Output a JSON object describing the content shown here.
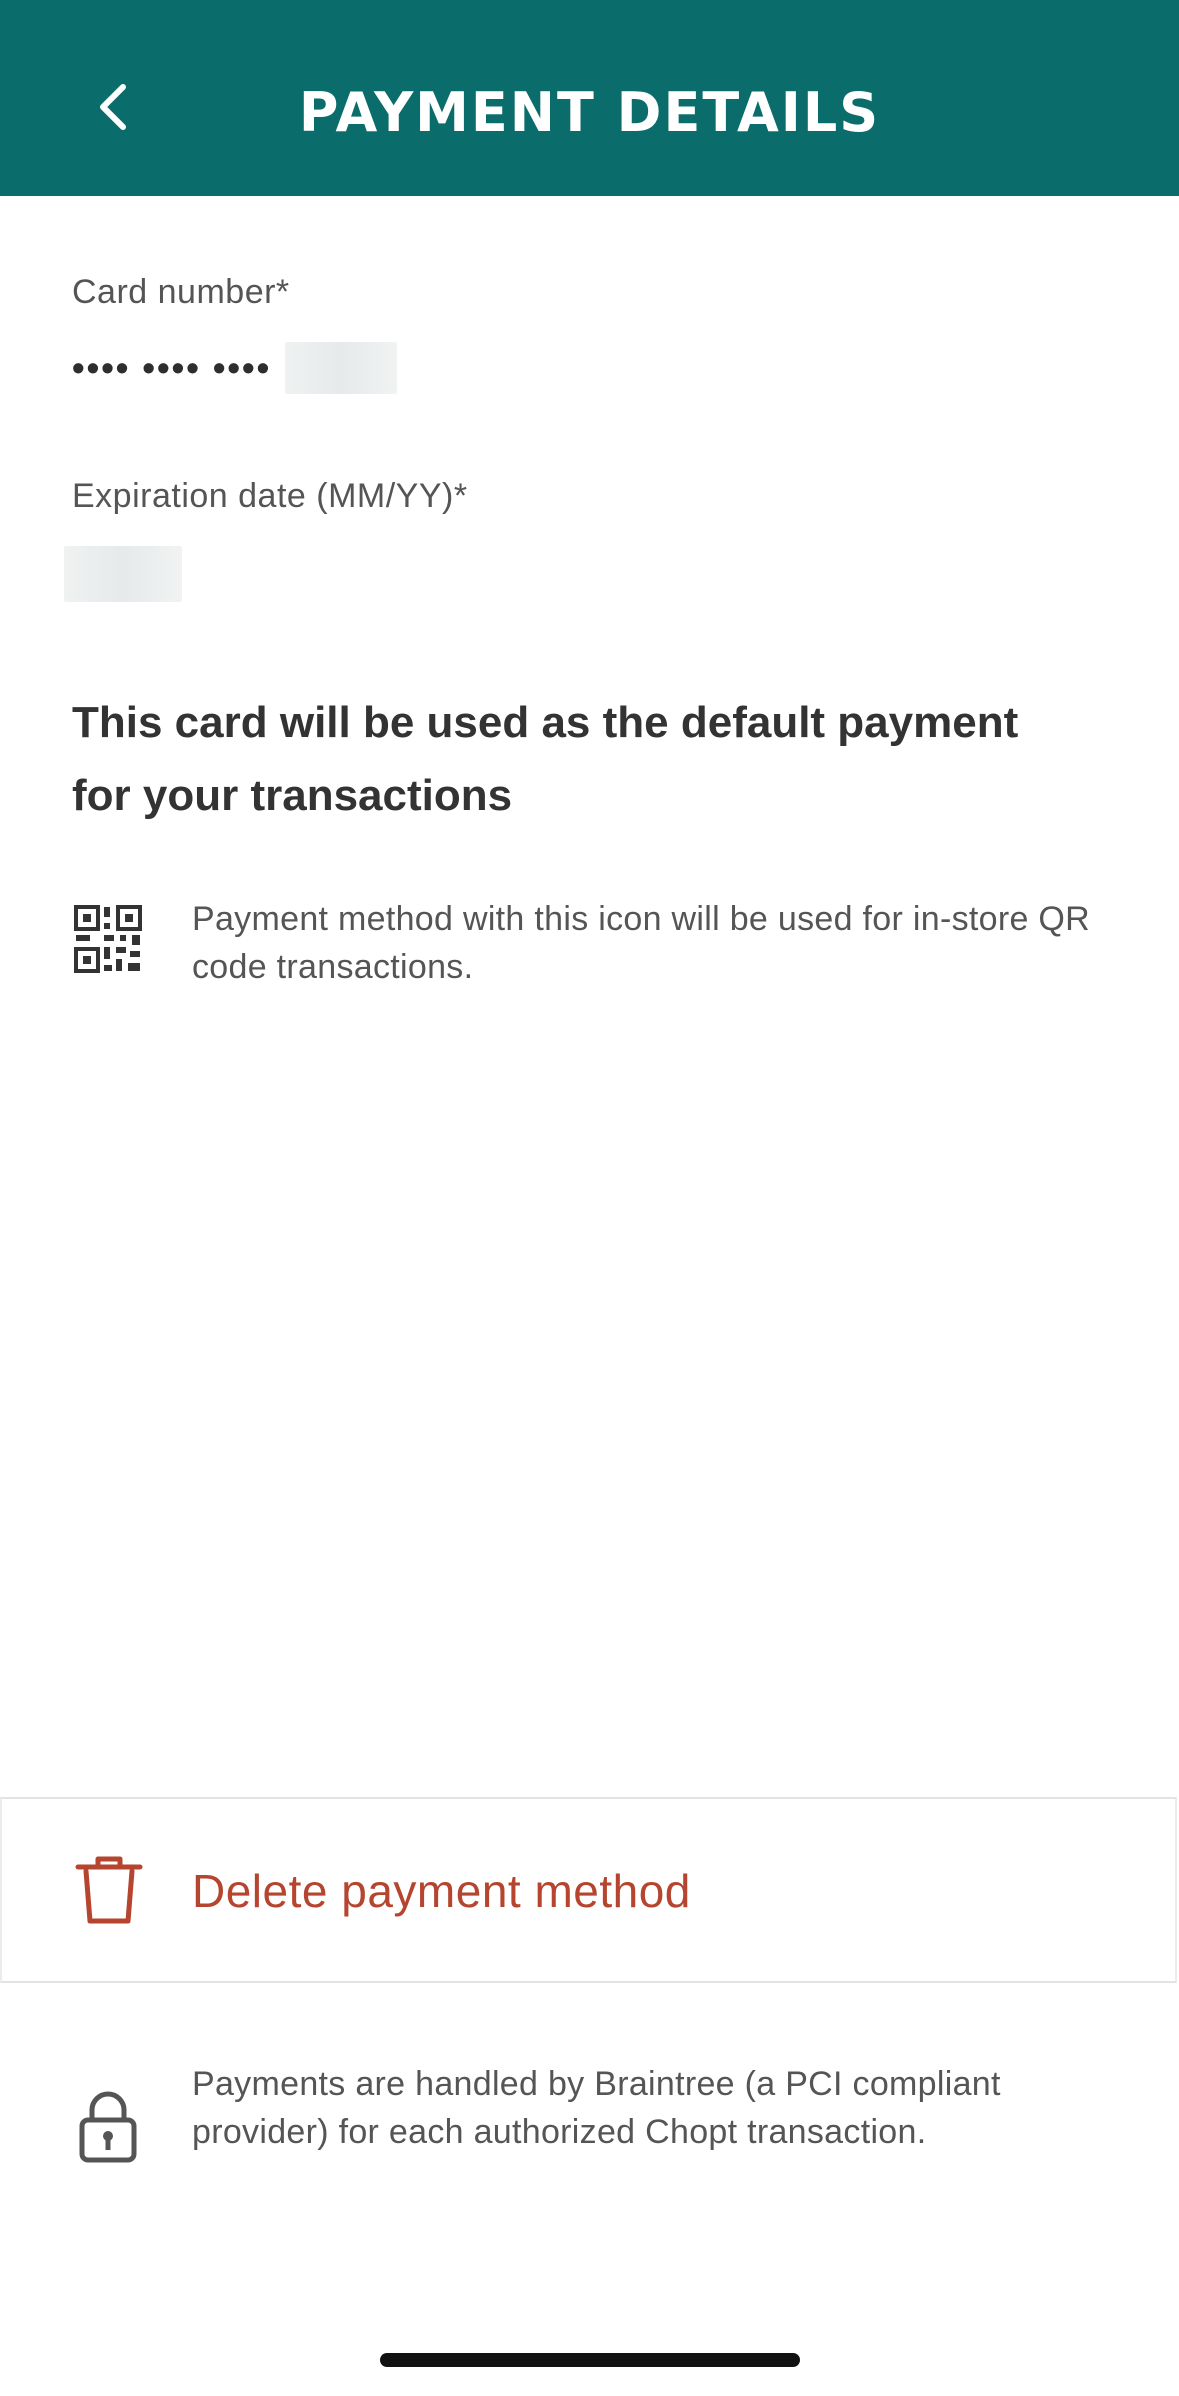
{
  "header": {
    "title": "PAYMENT DETAILS",
    "back_icon": "chevron-left-icon",
    "background_color": "#0b6c6c"
  },
  "card": {
    "label": "Card number*",
    "masked_value": "•••• •••• ••••"
  },
  "expiration": {
    "label": "Expiration date (MM/YY)*"
  },
  "default_note": "This card will be used as the default payment for your transactions",
  "qr_info": {
    "icon": "qr-code-icon",
    "text": "Payment method with this icon will be used for in-store QR code transactions."
  },
  "delete": {
    "icon": "trash-icon",
    "label": "Delete payment method",
    "color": "#b5452f"
  },
  "security": {
    "icon": "lock-icon",
    "text": "Payments are handled by Braintree (a PCI compliant provider) for each authorized Chopt transaction."
  }
}
